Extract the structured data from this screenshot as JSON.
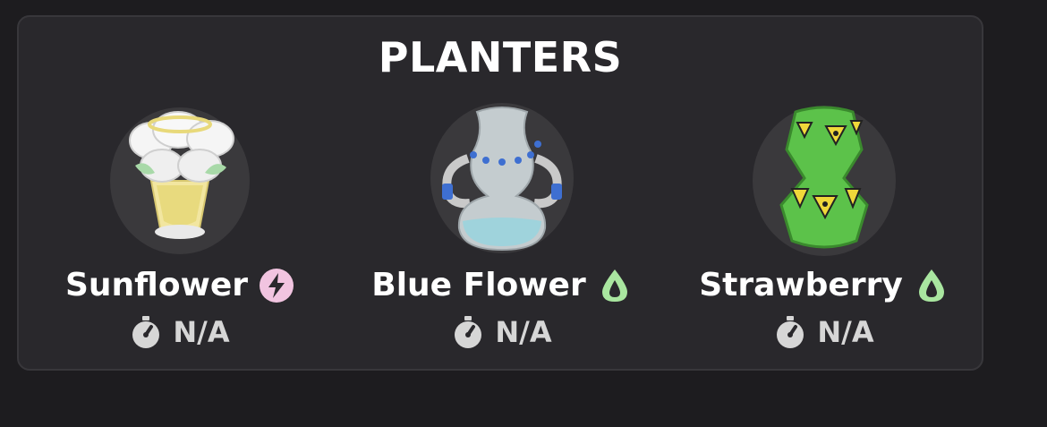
{
  "panel": {
    "title": "PLANTERS"
  },
  "planters": [
    {
      "name": "Sunflower",
      "badge_icon": "energy-bolt-icon",
      "badge_color": "#f1c4e0",
      "timer_icon": "stopwatch-icon",
      "timer_text": "N/A"
    },
    {
      "name": "Blue Flower",
      "badge_icon": "water-drop-icon",
      "badge_color": "#a9e6a0",
      "timer_icon": "stopwatch-icon",
      "timer_text": "N/A"
    },
    {
      "name": "Strawberry",
      "badge_icon": "water-drop-icon",
      "badge_color": "#a9e6a0",
      "timer_icon": "stopwatch-icon",
      "timer_text": "N/A"
    }
  ],
  "colors": {
    "background": "#1d1c1f",
    "panel": "#29282c",
    "text": "#ffffff",
    "timer_text": "#d6d6d6"
  }
}
